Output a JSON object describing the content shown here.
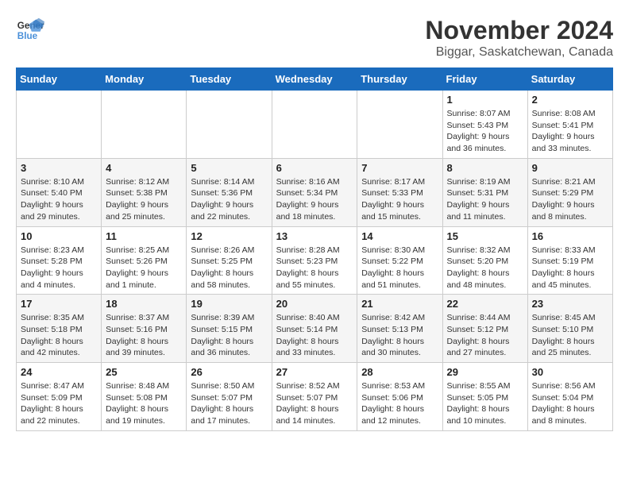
{
  "header": {
    "logo_line1": "General",
    "logo_line2": "Blue",
    "month": "November 2024",
    "location": "Biggar, Saskatchewan, Canada"
  },
  "days_of_week": [
    "Sunday",
    "Monday",
    "Tuesday",
    "Wednesday",
    "Thursday",
    "Friday",
    "Saturday"
  ],
  "weeks": [
    [
      {
        "day": "",
        "info": ""
      },
      {
        "day": "",
        "info": ""
      },
      {
        "day": "",
        "info": ""
      },
      {
        "day": "",
        "info": ""
      },
      {
        "day": "",
        "info": ""
      },
      {
        "day": "1",
        "info": "Sunrise: 8:07 AM\nSunset: 5:43 PM\nDaylight: 9 hours and 36 minutes."
      },
      {
        "day": "2",
        "info": "Sunrise: 8:08 AM\nSunset: 5:41 PM\nDaylight: 9 hours and 33 minutes."
      }
    ],
    [
      {
        "day": "3",
        "info": "Sunrise: 8:10 AM\nSunset: 5:40 PM\nDaylight: 9 hours and 29 minutes."
      },
      {
        "day": "4",
        "info": "Sunrise: 8:12 AM\nSunset: 5:38 PM\nDaylight: 9 hours and 25 minutes."
      },
      {
        "day": "5",
        "info": "Sunrise: 8:14 AM\nSunset: 5:36 PM\nDaylight: 9 hours and 22 minutes."
      },
      {
        "day": "6",
        "info": "Sunrise: 8:16 AM\nSunset: 5:34 PM\nDaylight: 9 hours and 18 minutes."
      },
      {
        "day": "7",
        "info": "Sunrise: 8:17 AM\nSunset: 5:33 PM\nDaylight: 9 hours and 15 minutes."
      },
      {
        "day": "8",
        "info": "Sunrise: 8:19 AM\nSunset: 5:31 PM\nDaylight: 9 hours and 11 minutes."
      },
      {
        "day": "9",
        "info": "Sunrise: 8:21 AM\nSunset: 5:29 PM\nDaylight: 9 hours and 8 minutes."
      }
    ],
    [
      {
        "day": "10",
        "info": "Sunrise: 8:23 AM\nSunset: 5:28 PM\nDaylight: 9 hours and 4 minutes."
      },
      {
        "day": "11",
        "info": "Sunrise: 8:25 AM\nSunset: 5:26 PM\nDaylight: 9 hours and 1 minute."
      },
      {
        "day": "12",
        "info": "Sunrise: 8:26 AM\nSunset: 5:25 PM\nDaylight: 8 hours and 58 minutes."
      },
      {
        "day": "13",
        "info": "Sunrise: 8:28 AM\nSunset: 5:23 PM\nDaylight: 8 hours and 55 minutes."
      },
      {
        "day": "14",
        "info": "Sunrise: 8:30 AM\nSunset: 5:22 PM\nDaylight: 8 hours and 51 minutes."
      },
      {
        "day": "15",
        "info": "Sunrise: 8:32 AM\nSunset: 5:20 PM\nDaylight: 8 hours and 48 minutes."
      },
      {
        "day": "16",
        "info": "Sunrise: 8:33 AM\nSunset: 5:19 PM\nDaylight: 8 hours and 45 minutes."
      }
    ],
    [
      {
        "day": "17",
        "info": "Sunrise: 8:35 AM\nSunset: 5:18 PM\nDaylight: 8 hours and 42 minutes."
      },
      {
        "day": "18",
        "info": "Sunrise: 8:37 AM\nSunset: 5:16 PM\nDaylight: 8 hours and 39 minutes."
      },
      {
        "day": "19",
        "info": "Sunrise: 8:39 AM\nSunset: 5:15 PM\nDaylight: 8 hours and 36 minutes."
      },
      {
        "day": "20",
        "info": "Sunrise: 8:40 AM\nSunset: 5:14 PM\nDaylight: 8 hours and 33 minutes."
      },
      {
        "day": "21",
        "info": "Sunrise: 8:42 AM\nSunset: 5:13 PM\nDaylight: 8 hours and 30 minutes."
      },
      {
        "day": "22",
        "info": "Sunrise: 8:44 AM\nSunset: 5:12 PM\nDaylight: 8 hours and 27 minutes."
      },
      {
        "day": "23",
        "info": "Sunrise: 8:45 AM\nSunset: 5:10 PM\nDaylight: 8 hours and 25 minutes."
      }
    ],
    [
      {
        "day": "24",
        "info": "Sunrise: 8:47 AM\nSunset: 5:09 PM\nDaylight: 8 hours and 22 minutes."
      },
      {
        "day": "25",
        "info": "Sunrise: 8:48 AM\nSunset: 5:08 PM\nDaylight: 8 hours and 19 minutes."
      },
      {
        "day": "26",
        "info": "Sunrise: 8:50 AM\nSunset: 5:07 PM\nDaylight: 8 hours and 17 minutes."
      },
      {
        "day": "27",
        "info": "Sunrise: 8:52 AM\nSunset: 5:07 PM\nDaylight: 8 hours and 14 minutes."
      },
      {
        "day": "28",
        "info": "Sunrise: 8:53 AM\nSunset: 5:06 PM\nDaylight: 8 hours and 12 minutes."
      },
      {
        "day": "29",
        "info": "Sunrise: 8:55 AM\nSunset: 5:05 PM\nDaylight: 8 hours and 10 minutes."
      },
      {
        "day": "30",
        "info": "Sunrise: 8:56 AM\nSunset: 5:04 PM\nDaylight: 8 hours and 8 minutes."
      }
    ]
  ]
}
